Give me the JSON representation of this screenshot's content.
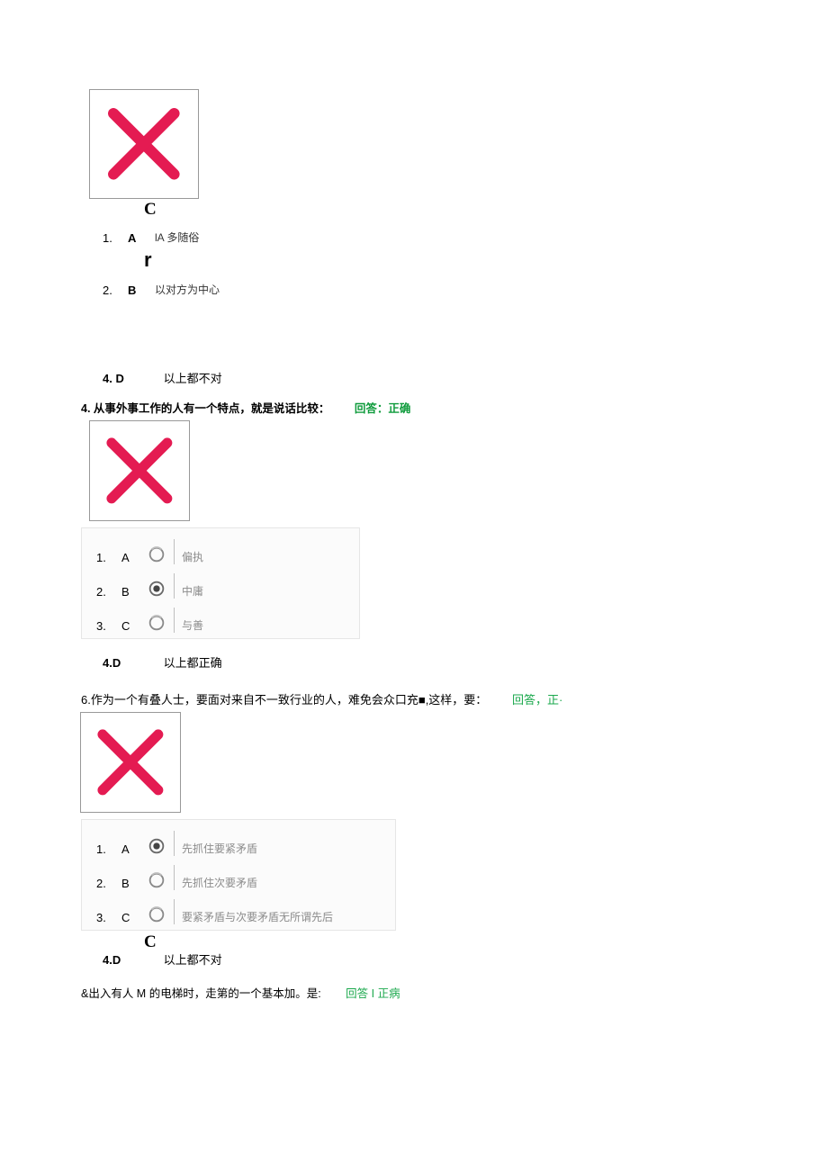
{
  "q3": {
    "big_glyph_a": "C",
    "optA": {
      "num": "1.",
      "let": "A",
      "txt": "lA 多随俗"
    },
    "big_glyph_b": "r",
    "optB": {
      "num": "2.",
      "let": "B",
      "txt": "以对方为中心"
    },
    "optD": {
      "label": "4. D",
      "txt": "以上都不对"
    }
  },
  "q4": {
    "stem": "4. 从事外事工作的人有一个特点，就是说话比较：",
    "ans_label": "回答：正确",
    "optA": {
      "num": "1.",
      "let": "A",
      "txt": "偏执"
    },
    "optB": {
      "num": "2.",
      "let": "B",
      "txt": "中庸"
    },
    "optC": {
      "num": "3.",
      "let": "C",
      "txt": "与善"
    },
    "optD": {
      "label": "4.D",
      "txt": "以上都正确"
    }
  },
  "q6": {
    "stem": "6.作为一个有叠人士，要面对来自不一致行业的人，难免会众口充■,这样，要：",
    "ans_label": "回答，正·",
    "optA": {
      "num": "1.",
      "let": "A",
      "txt": "先抓住要紧矛盾"
    },
    "optB": {
      "num": "2.",
      "let": "B",
      "txt": "先抓住次要矛盾"
    },
    "optC": {
      "num": "3.",
      "let": "C",
      "txt": "要紧矛盾与次要矛盾无所谓先后"
    },
    "big_glyph_d": "C",
    "optD": {
      "label": "4.D",
      "txt": "以上都不对"
    }
  },
  "q8": {
    "stem": "&出入有人 M 的电梯时，走第的一个基本加。是:",
    "ans_label": "回答 I 正病"
  }
}
